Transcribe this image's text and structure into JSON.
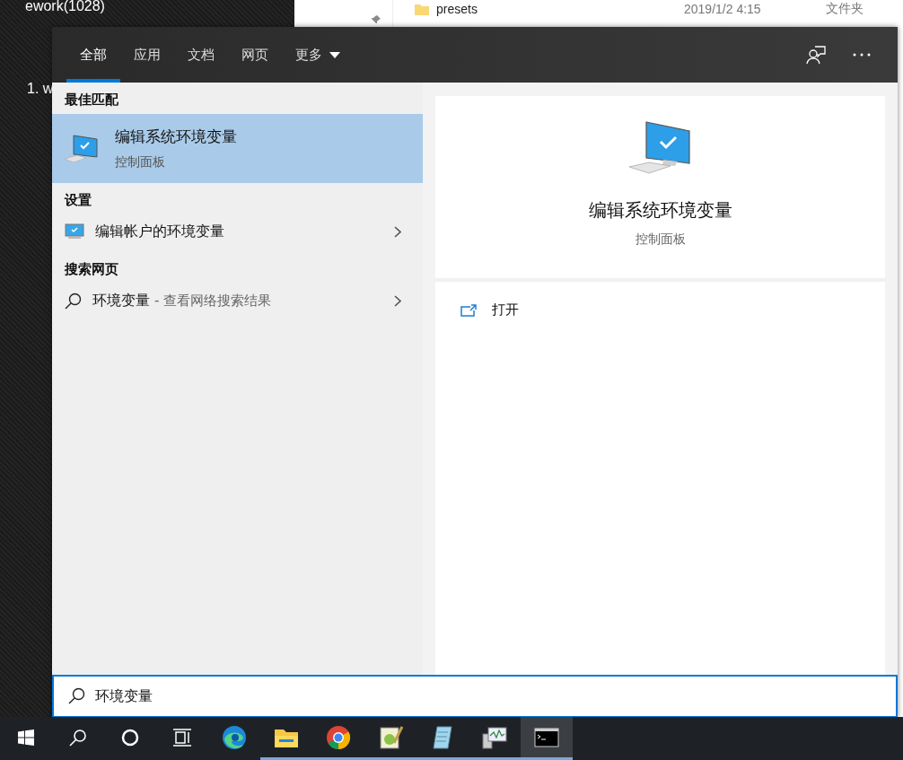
{
  "desktop": {
    "texts": [
      "ework(1028)",
      "1. w"
    ]
  },
  "explorer": {
    "rows": [
      {
        "kind": "folder",
        "name": "presets",
        "date": "2019/1/2 4:15",
        "type": "文件夹"
      }
    ]
  },
  "search": {
    "tabs": [
      {
        "label": "全部",
        "selected": true,
        "dropdown": false
      },
      {
        "label": "应用",
        "selected": false,
        "dropdown": false
      },
      {
        "label": "文档",
        "selected": false,
        "dropdown": false
      },
      {
        "label": "网页",
        "selected": false,
        "dropdown": false
      },
      {
        "label": "更多",
        "selected": false,
        "dropdown": true
      }
    ],
    "sections": [
      {
        "heading": "最佳匹配",
        "items": [
          {
            "kind": "app",
            "title": "编辑系统环境变量",
            "subtitle": "控制面板",
            "selected": true
          }
        ]
      },
      {
        "heading": "设置",
        "items": [
          {
            "kind": "setting",
            "title": "编辑帐户的环境变量",
            "selected": false
          }
        ]
      },
      {
        "heading": "搜索网页",
        "items": [
          {
            "kind": "web",
            "title": "环境变量",
            "suffix": "- 查看网络搜索结果",
            "selected": false
          }
        ]
      }
    ],
    "preview": {
      "title": "编辑系统环境变量",
      "subtitle": "控制面板",
      "actions": [
        {
          "label": "打开"
        }
      ]
    },
    "query": "环境变量"
  },
  "taskbar": [
    {
      "kind": "start",
      "running": false,
      "selected": false
    },
    {
      "kind": "search",
      "running": false,
      "selected": false
    },
    {
      "kind": "cortana",
      "running": false,
      "selected": false
    },
    {
      "kind": "taskview",
      "running": false,
      "selected": false
    },
    {
      "kind": "edge",
      "running": false,
      "selected": false
    },
    {
      "kind": "files",
      "running": true,
      "selected": false
    },
    {
      "kind": "chrome",
      "running": true,
      "selected": false
    },
    {
      "kind": "editor",
      "running": true,
      "selected": false
    },
    {
      "kind": "notepad",
      "running": true,
      "selected": false
    },
    {
      "kind": "monitor",
      "running": true,
      "selected": false
    },
    {
      "kind": "terminal",
      "running": true,
      "selected": true
    }
  ]
}
